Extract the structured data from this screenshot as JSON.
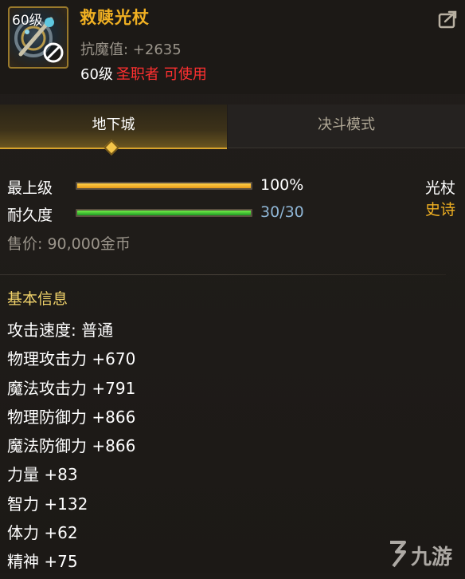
{
  "item": {
    "level_badge": "60级",
    "name": "救赎光杖",
    "magic_resist": "抗魔值: +2635",
    "req_level": "60级",
    "req_class": "圣职者",
    "usable": "可使用"
  },
  "tabs": [
    {
      "label": "地下城",
      "active": true
    },
    {
      "label": "决斗模式",
      "active": false
    }
  ],
  "status": {
    "grade_label": "最上级",
    "grade_value": "100%",
    "grade_fraction": 1.0,
    "durability_label": "耐久度",
    "durability_value": "30/30",
    "durability_fraction": 1.0,
    "weapon_type": "光杖",
    "rarity": "史诗",
    "price": "售价: 90,000金币"
  },
  "basic_info": {
    "title": "基本信息",
    "attributes": [
      "攻击速度: 普通",
      "物理攻击力 +670",
      "魔法攻击力 +791",
      "物理防御力 +866",
      "魔法防御力 +866",
      "力量 +83",
      "智力 +132",
      "体力 +62",
      "精神 +75"
    ]
  },
  "watermark": {
    "text": "九游",
    "icon": "jiuyou-logo-icon"
  },
  "colors": {
    "item_name": "#f0b022",
    "class_requirement": "#ff3030",
    "rarity": "#f0b022",
    "durability_text": "#8fb6d6",
    "section_title": "#f0d26a"
  }
}
